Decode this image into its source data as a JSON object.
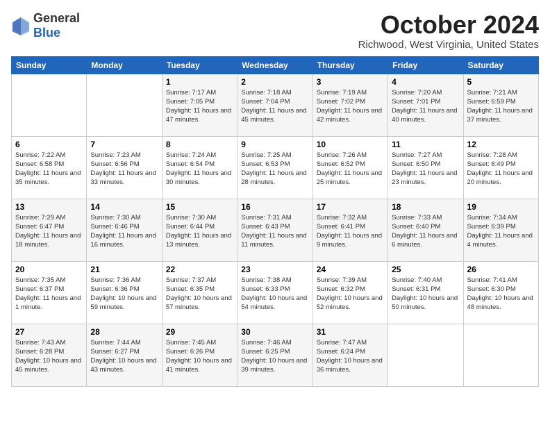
{
  "logo": {
    "general": "General",
    "blue": "Blue"
  },
  "header": {
    "month": "October 2024",
    "location": "Richwood, West Virginia, United States"
  },
  "weekdays": [
    "Sunday",
    "Monday",
    "Tuesday",
    "Wednesday",
    "Thursday",
    "Friday",
    "Saturday"
  ],
  "weeks": [
    [
      {
        "day": "",
        "info": ""
      },
      {
        "day": "",
        "info": ""
      },
      {
        "day": "1",
        "info": "Sunrise: 7:17 AM\nSunset: 7:05 PM\nDaylight: 11 hours and 47 minutes."
      },
      {
        "day": "2",
        "info": "Sunrise: 7:18 AM\nSunset: 7:04 PM\nDaylight: 11 hours and 45 minutes."
      },
      {
        "day": "3",
        "info": "Sunrise: 7:19 AM\nSunset: 7:02 PM\nDaylight: 11 hours and 42 minutes."
      },
      {
        "day": "4",
        "info": "Sunrise: 7:20 AM\nSunset: 7:01 PM\nDaylight: 11 hours and 40 minutes."
      },
      {
        "day": "5",
        "info": "Sunrise: 7:21 AM\nSunset: 6:59 PM\nDaylight: 11 hours and 37 minutes."
      }
    ],
    [
      {
        "day": "6",
        "info": "Sunrise: 7:22 AM\nSunset: 6:58 PM\nDaylight: 11 hours and 35 minutes."
      },
      {
        "day": "7",
        "info": "Sunrise: 7:23 AM\nSunset: 6:56 PM\nDaylight: 11 hours and 33 minutes."
      },
      {
        "day": "8",
        "info": "Sunrise: 7:24 AM\nSunset: 6:54 PM\nDaylight: 11 hours and 30 minutes."
      },
      {
        "day": "9",
        "info": "Sunrise: 7:25 AM\nSunset: 6:53 PM\nDaylight: 11 hours and 28 minutes."
      },
      {
        "day": "10",
        "info": "Sunrise: 7:26 AM\nSunset: 6:52 PM\nDaylight: 11 hours and 25 minutes."
      },
      {
        "day": "11",
        "info": "Sunrise: 7:27 AM\nSunset: 6:50 PM\nDaylight: 11 hours and 23 minutes."
      },
      {
        "day": "12",
        "info": "Sunrise: 7:28 AM\nSunset: 6:49 PM\nDaylight: 11 hours and 20 minutes."
      }
    ],
    [
      {
        "day": "13",
        "info": "Sunrise: 7:29 AM\nSunset: 6:47 PM\nDaylight: 11 hours and 18 minutes."
      },
      {
        "day": "14",
        "info": "Sunrise: 7:30 AM\nSunset: 6:46 PM\nDaylight: 11 hours and 16 minutes."
      },
      {
        "day": "15",
        "info": "Sunrise: 7:30 AM\nSunset: 6:44 PM\nDaylight: 11 hours and 13 minutes."
      },
      {
        "day": "16",
        "info": "Sunrise: 7:31 AM\nSunset: 6:43 PM\nDaylight: 11 hours and 11 minutes."
      },
      {
        "day": "17",
        "info": "Sunrise: 7:32 AM\nSunset: 6:41 PM\nDaylight: 11 hours and 9 minutes."
      },
      {
        "day": "18",
        "info": "Sunrise: 7:33 AM\nSunset: 6:40 PM\nDaylight: 11 hours and 6 minutes."
      },
      {
        "day": "19",
        "info": "Sunrise: 7:34 AM\nSunset: 6:39 PM\nDaylight: 11 hours and 4 minutes."
      }
    ],
    [
      {
        "day": "20",
        "info": "Sunrise: 7:35 AM\nSunset: 6:37 PM\nDaylight: 11 hours and 1 minute."
      },
      {
        "day": "21",
        "info": "Sunrise: 7:36 AM\nSunset: 6:36 PM\nDaylight: 10 hours and 59 minutes."
      },
      {
        "day": "22",
        "info": "Sunrise: 7:37 AM\nSunset: 6:35 PM\nDaylight: 10 hours and 57 minutes."
      },
      {
        "day": "23",
        "info": "Sunrise: 7:38 AM\nSunset: 6:33 PM\nDaylight: 10 hours and 54 minutes."
      },
      {
        "day": "24",
        "info": "Sunrise: 7:39 AM\nSunset: 6:32 PM\nDaylight: 10 hours and 52 minutes."
      },
      {
        "day": "25",
        "info": "Sunrise: 7:40 AM\nSunset: 6:31 PM\nDaylight: 10 hours and 50 minutes."
      },
      {
        "day": "26",
        "info": "Sunrise: 7:41 AM\nSunset: 6:30 PM\nDaylight: 10 hours and 48 minutes."
      }
    ],
    [
      {
        "day": "27",
        "info": "Sunrise: 7:43 AM\nSunset: 6:28 PM\nDaylight: 10 hours and 45 minutes."
      },
      {
        "day": "28",
        "info": "Sunrise: 7:44 AM\nSunset: 6:27 PM\nDaylight: 10 hours and 43 minutes."
      },
      {
        "day": "29",
        "info": "Sunrise: 7:45 AM\nSunset: 6:26 PM\nDaylight: 10 hours and 41 minutes."
      },
      {
        "day": "30",
        "info": "Sunrise: 7:46 AM\nSunset: 6:25 PM\nDaylight: 10 hours and 39 minutes."
      },
      {
        "day": "31",
        "info": "Sunrise: 7:47 AM\nSunset: 6:24 PM\nDaylight: 10 hours and 36 minutes."
      },
      {
        "day": "",
        "info": ""
      },
      {
        "day": "",
        "info": ""
      }
    ]
  ]
}
